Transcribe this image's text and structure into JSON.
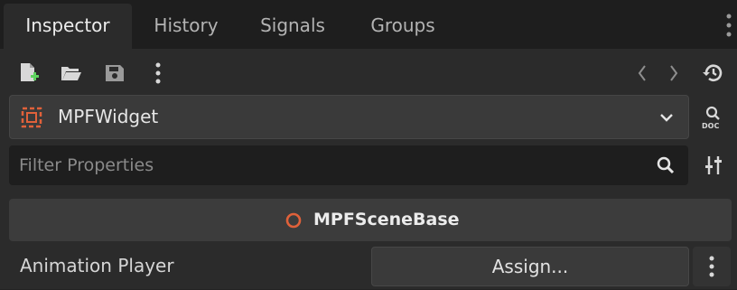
{
  "tabs": [
    {
      "label": "Inspector",
      "active": true
    },
    {
      "label": "History",
      "active": false
    },
    {
      "label": "Signals",
      "active": false
    },
    {
      "label": "Groups",
      "active": false
    }
  ],
  "toolbar": {
    "icons": [
      "new-resource-icon",
      "open-folder-icon",
      "save-icon",
      "more-options-icon",
      "history-back-icon",
      "history-forward-icon",
      "recent-history-icon"
    ]
  },
  "object_selector": {
    "icon": "control-node-icon",
    "label": "MPFWidget",
    "doc_icon": "open-docs-icon"
  },
  "filter": {
    "placeholder": "Filter Properties",
    "value": ""
  },
  "section": {
    "title": "MPFSceneBase",
    "icon": "script-circle-icon"
  },
  "properties": [
    {
      "label": "Animation Player",
      "value": "Assign..."
    }
  ],
  "colors": {
    "accent_orange": "#e0613a",
    "panel_bg": "#2b2b2b",
    "tabbar_bg": "#1e1e1e"
  }
}
